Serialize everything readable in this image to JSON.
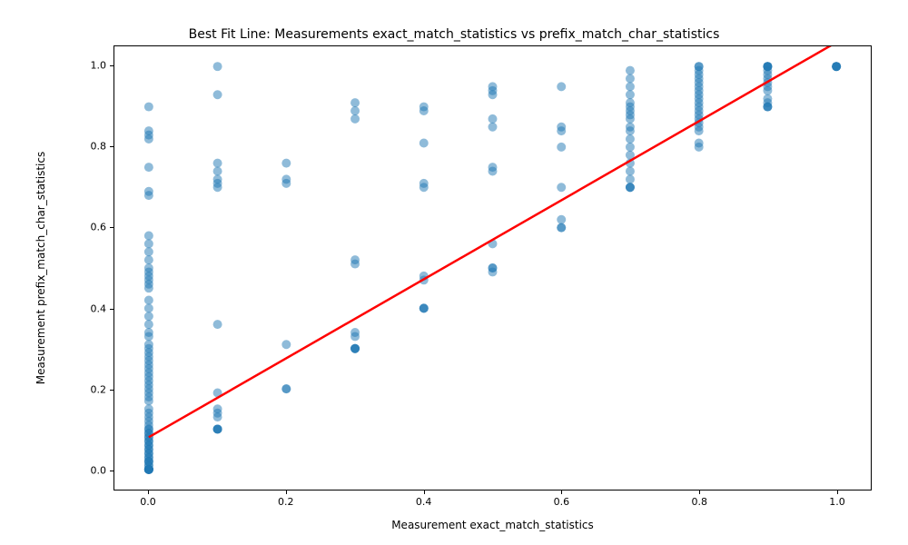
{
  "chart_data": {
    "type": "scatter",
    "title": "Best Fit Line: Measurements exact_match_statistics vs prefix_match_char_statistics",
    "xlabel": "Measurement exact_match_statistics",
    "ylabel": "Measurement prefix_match_char_statistics",
    "xlim": [
      -0.05,
      1.05
    ],
    "ylim": [
      -0.05,
      1.05
    ],
    "xticks": [
      0.0,
      0.2,
      0.4,
      0.6,
      0.8,
      1.0
    ],
    "yticks": [
      0.0,
      0.2,
      0.4,
      0.6,
      0.8,
      1.0
    ],
    "scatter_color": "#1f77b4",
    "scatter_alpha": 0.5,
    "line_color": "#ff0000",
    "fit_line": {
      "x": [
        0.0,
        1.0
      ],
      "y": [
        0.08,
        1.06
      ]
    },
    "points": [
      [
        0.0,
        0.0
      ],
      [
        0.0,
        0.0
      ],
      [
        0.0,
        0.0
      ],
      [
        0.0,
        0.0
      ],
      [
        0.0,
        0.0
      ],
      [
        0.0,
        0.0
      ],
      [
        0.0,
        0.0
      ],
      [
        0.0,
        0.0
      ],
      [
        0.0,
        0.0
      ],
      [
        0.0,
        0.0
      ],
      [
        0.0,
        0.01
      ],
      [
        0.0,
        0.01
      ],
      [
        0.0,
        0.02
      ],
      [
        0.0,
        0.02
      ],
      [
        0.0,
        0.02
      ],
      [
        0.0,
        0.03
      ],
      [
        0.0,
        0.03
      ],
      [
        0.0,
        0.04
      ],
      [
        0.0,
        0.04
      ],
      [
        0.0,
        0.05
      ],
      [
        0.0,
        0.05
      ],
      [
        0.0,
        0.06
      ],
      [
        0.0,
        0.06
      ],
      [
        0.0,
        0.07
      ],
      [
        0.0,
        0.07
      ],
      [
        0.0,
        0.08
      ],
      [
        0.0,
        0.08
      ],
      [
        0.0,
        0.09
      ],
      [
        0.0,
        0.09
      ],
      [
        0.0,
        0.1
      ],
      [
        0.0,
        0.1
      ],
      [
        0.0,
        0.11
      ],
      [
        0.0,
        0.12
      ],
      [
        0.0,
        0.13
      ],
      [
        0.0,
        0.14
      ],
      [
        0.0,
        0.15
      ],
      [
        0.0,
        0.17
      ],
      [
        0.0,
        0.18
      ],
      [
        0.0,
        0.19
      ],
      [
        0.0,
        0.2
      ],
      [
        0.0,
        0.21
      ],
      [
        0.0,
        0.22
      ],
      [
        0.0,
        0.23
      ],
      [
        0.0,
        0.24
      ],
      [
        0.0,
        0.25
      ],
      [
        0.0,
        0.26
      ],
      [
        0.0,
        0.27
      ],
      [
        0.0,
        0.28
      ],
      [
        0.0,
        0.29
      ],
      [
        0.0,
        0.3
      ],
      [
        0.0,
        0.31
      ],
      [
        0.0,
        0.33
      ],
      [
        0.0,
        0.34
      ],
      [
        0.0,
        0.36
      ],
      [
        0.0,
        0.38
      ],
      [
        0.0,
        0.4
      ],
      [
        0.0,
        0.42
      ],
      [
        0.0,
        0.45
      ],
      [
        0.0,
        0.46
      ],
      [
        0.0,
        0.47
      ],
      [
        0.0,
        0.48
      ],
      [
        0.0,
        0.49
      ],
      [
        0.0,
        0.5
      ],
      [
        0.0,
        0.52
      ],
      [
        0.0,
        0.54
      ],
      [
        0.0,
        0.56
      ],
      [
        0.0,
        0.58
      ],
      [
        0.0,
        0.68
      ],
      [
        0.0,
        0.69
      ],
      [
        0.0,
        0.75
      ],
      [
        0.0,
        0.82
      ],
      [
        0.0,
        0.83
      ],
      [
        0.0,
        0.84
      ],
      [
        0.0,
        0.9
      ],
      [
        0.1,
        0.1
      ],
      [
        0.1,
        0.1
      ],
      [
        0.1,
        0.1
      ],
      [
        0.1,
        0.1
      ],
      [
        0.1,
        0.13
      ],
      [
        0.1,
        0.14
      ],
      [
        0.1,
        0.15
      ],
      [
        0.1,
        0.19
      ],
      [
        0.1,
        0.36
      ],
      [
        0.1,
        0.7
      ],
      [
        0.1,
        0.71
      ],
      [
        0.1,
        0.72
      ],
      [
        0.1,
        0.74
      ],
      [
        0.1,
        0.76
      ],
      [
        0.1,
        0.93
      ],
      [
        0.1,
        1.0
      ],
      [
        0.2,
        0.2
      ],
      [
        0.2,
        0.2
      ],
      [
        0.2,
        0.31
      ],
      [
        0.2,
        0.71
      ],
      [
        0.2,
        0.72
      ],
      [
        0.2,
        0.76
      ],
      [
        0.3,
        0.3
      ],
      [
        0.3,
        0.3
      ],
      [
        0.3,
        0.3
      ],
      [
        0.3,
        0.3
      ],
      [
        0.3,
        0.33
      ],
      [
        0.3,
        0.34
      ],
      [
        0.3,
        0.51
      ],
      [
        0.3,
        0.52
      ],
      [
        0.3,
        0.87
      ],
      [
        0.3,
        0.89
      ],
      [
        0.3,
        0.91
      ],
      [
        0.4,
        0.4
      ],
      [
        0.4,
        0.4
      ],
      [
        0.4,
        0.4
      ],
      [
        0.4,
        0.47
      ],
      [
        0.4,
        0.48
      ],
      [
        0.4,
        0.7
      ],
      [
        0.4,
        0.71
      ],
      [
        0.4,
        0.81
      ],
      [
        0.4,
        0.89
      ],
      [
        0.4,
        0.9
      ],
      [
        0.5,
        0.49
      ],
      [
        0.5,
        0.5
      ],
      [
        0.5,
        0.5
      ],
      [
        0.5,
        0.56
      ],
      [
        0.5,
        0.74
      ],
      [
        0.5,
        0.75
      ],
      [
        0.5,
        0.85
      ],
      [
        0.5,
        0.87
      ],
      [
        0.5,
        0.93
      ],
      [
        0.5,
        0.94
      ],
      [
        0.5,
        0.95
      ],
      [
        0.6,
        0.6
      ],
      [
        0.6,
        0.6
      ],
      [
        0.6,
        0.62
      ],
      [
        0.6,
        0.7
      ],
      [
        0.6,
        0.8
      ],
      [
        0.6,
        0.84
      ],
      [
        0.6,
        0.85
      ],
      [
        0.6,
        0.95
      ],
      [
        0.7,
        0.7
      ],
      [
        0.7,
        0.7
      ],
      [
        0.7,
        0.7
      ],
      [
        0.7,
        0.72
      ],
      [
        0.7,
        0.74
      ],
      [
        0.7,
        0.76
      ],
      [
        0.7,
        0.78
      ],
      [
        0.7,
        0.8
      ],
      [
        0.7,
        0.82
      ],
      [
        0.7,
        0.84
      ],
      [
        0.7,
        0.85
      ],
      [
        0.7,
        0.87
      ],
      [
        0.7,
        0.88
      ],
      [
        0.7,
        0.89
      ],
      [
        0.7,
        0.9
      ],
      [
        0.7,
        0.91
      ],
      [
        0.7,
        0.93
      ],
      [
        0.7,
        0.95
      ],
      [
        0.7,
        0.97
      ],
      [
        0.7,
        0.99
      ],
      [
        0.8,
        0.8
      ],
      [
        0.8,
        0.81
      ],
      [
        0.8,
        0.84
      ],
      [
        0.8,
        0.85
      ],
      [
        0.8,
        0.86
      ],
      [
        0.8,
        0.87
      ],
      [
        0.8,
        0.88
      ],
      [
        0.8,
        0.89
      ],
      [
        0.8,
        0.9
      ],
      [
        0.8,
        0.91
      ],
      [
        0.8,
        0.92
      ],
      [
        0.8,
        0.93
      ],
      [
        0.8,
        0.94
      ],
      [
        0.8,
        0.95
      ],
      [
        0.8,
        0.96
      ],
      [
        0.8,
        0.97
      ],
      [
        0.8,
        0.98
      ],
      [
        0.8,
        0.99
      ],
      [
        0.8,
        1.0
      ],
      [
        0.8,
        1.0
      ],
      [
        0.9,
        0.9
      ],
      [
        0.9,
        0.9
      ],
      [
        0.9,
        0.9
      ],
      [
        0.9,
        0.91
      ],
      [
        0.9,
        0.92
      ],
      [
        0.9,
        0.94
      ],
      [
        0.9,
        0.95
      ],
      [
        0.9,
        0.96
      ],
      [
        0.9,
        0.97
      ],
      [
        0.9,
        0.98
      ],
      [
        0.9,
        0.99
      ],
      [
        0.9,
        1.0
      ],
      [
        0.9,
        1.0
      ],
      [
        0.9,
        1.0
      ],
      [
        0.9,
        1.0
      ],
      [
        0.9,
        1.0
      ],
      [
        1.0,
        1.0
      ],
      [
        1.0,
        1.0
      ],
      [
        1.0,
        1.0
      ],
      [
        1.0,
        1.0
      ],
      [
        1.0,
        1.0
      ]
    ]
  }
}
